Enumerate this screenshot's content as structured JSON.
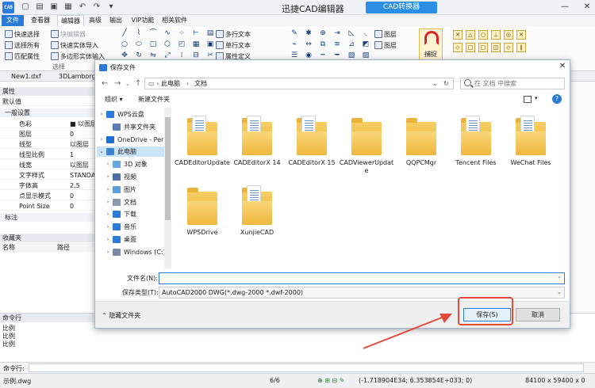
{
  "app": {
    "logo": "CAD",
    "title": "迅捷CAD编辑器",
    "converter": "CAD转换器",
    "quick_access": [
      "new-icon",
      "open-icon",
      "save-icon",
      "print-icon",
      "undo-icon",
      "redo-icon",
      "dropdown-icon"
    ]
  },
  "ribbon_tabs": [
    "文件",
    "查看器",
    "编辑器",
    "高级",
    "输出",
    "VIP功能",
    "相关软件"
  ],
  "ribbon": {
    "select_group": {
      "items": [
        "快速选择",
        "选择所有",
        "匹配属性"
      ],
      "label": "选择"
    },
    "block_group": [
      "块编辑器",
      "快速实体导入",
      "多边形实体输入"
    ],
    "text_group": [
      "多行文本",
      "单行文本",
      "属性定义"
    ],
    "layer_group": [
      "图层",
      "图层"
    ],
    "capture": "捕捉"
  },
  "doc_tabs": [
    "New1.dxf",
    "3DLamborgini.A"
  ],
  "props": {
    "header": "属性",
    "default_label": "默认值",
    "general_section": "一般设置",
    "rows": [
      {
        "k": "色彩",
        "v": "■ 以图层"
      },
      {
        "k": "图层",
        "v": "0"
      },
      {
        "k": "线型",
        "v": "以图层"
      },
      {
        "k": "线型比例",
        "v": "1"
      },
      {
        "k": "线宽",
        "v": "以图层"
      },
      {
        "k": "文字样式",
        "v": "STANDARD"
      },
      {
        "k": "字体高",
        "v": "2.5"
      },
      {
        "k": "点显示模式",
        "v": "0"
      },
      {
        "k": "Point Size",
        "v": "0"
      }
    ],
    "annotation_section": "标注",
    "favorites_header": "收藏夹",
    "fav_cols": [
      "名称",
      "路径"
    ]
  },
  "command": {
    "header": "命令行",
    "history": [
      "比例",
      "比例",
      "比例"
    ],
    "input_label": "命令行:"
  },
  "status": {
    "file": "示例.dwg",
    "pages": "6/6",
    "coords": "(-1.718904E34; 6.353854E+033; 0)",
    "size": "84100 x 59400 x 0"
  },
  "dialog": {
    "title": "保存文件",
    "path": [
      "此电脑",
      "文档"
    ],
    "search_placeholder": "在 文档 中搜索",
    "organize": "组织 ▾",
    "new_folder": "新建文件夹",
    "tree": [
      {
        "label": "WPS云盘",
        "icon": "cloud-icon",
        "indent": 1,
        "chev": "›"
      },
      {
        "label": "共享文件夹",
        "icon": "share-icon",
        "indent": 2,
        "chev": ""
      },
      {
        "label": "OneDrive - Perso",
        "icon": "onedrive-icon",
        "indent": 1,
        "chev": "›"
      },
      {
        "label": "此电脑",
        "icon": "computer-icon",
        "indent": 1,
        "chev": "⌄"
      },
      {
        "label": "3D 对象",
        "icon": "3d-objects-icon",
        "indent": 2,
        "chev": "›"
      },
      {
        "label": "视频",
        "icon": "video-icon",
        "indent": 2,
        "chev": "›"
      },
      {
        "label": "图片",
        "icon": "pictures-icon",
        "indent": 2,
        "chev": "›"
      },
      {
        "label": "文档",
        "icon": "documents-icon",
        "indent": 2,
        "chev": "›"
      },
      {
        "label": "下载",
        "icon": "downloads-icon",
        "indent": 2,
        "chev": "›"
      },
      {
        "label": "音乐",
        "icon": "music-icon",
        "indent": 2,
        "chev": "›"
      },
      {
        "label": "桌面",
        "icon": "desktop-icon",
        "indent": 2,
        "chev": "›"
      },
      {
        "label": "Windows (C:)",
        "icon": "drive-icon",
        "indent": 2,
        "chev": "›"
      }
    ],
    "files": [
      {
        "name": "CADEditorUpdate",
        "paper": true
      },
      {
        "name": "CADEditorX 14",
        "paper": true
      },
      {
        "name": "CADEditorX 15",
        "paper": true
      },
      {
        "name": "CADViewerUpdate",
        "paper": false
      },
      {
        "name": "QQPCMgr",
        "paper": false
      },
      {
        "name": "Tencent Files",
        "paper": true
      },
      {
        "name": "WeChat Files",
        "paper": true
      },
      {
        "name": "WPSDrive",
        "paper": false
      },
      {
        "name": "XunjieCAD",
        "paper": true
      }
    ],
    "filename_label": "文件名(N):",
    "filename_value": "",
    "filetype_label": "保存类型(T):",
    "filetype_value": "AutoCAD2000 DWG(*.dwg-2000 *.dwf-2000)",
    "hide_folders": "隐藏文件夹",
    "save": "保存(S)",
    "cancel": "取消"
  },
  "colors": {
    "accent": "#2b7ad8",
    "annotation": "#e24b3b",
    "folder": "#eab43a"
  }
}
